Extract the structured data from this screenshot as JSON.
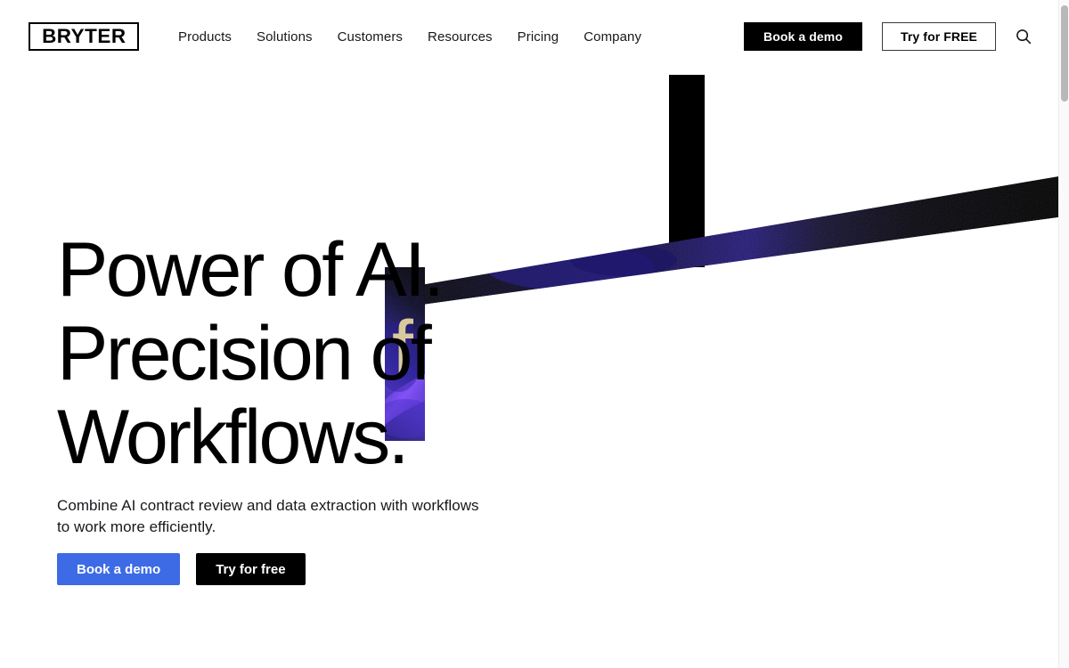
{
  "header": {
    "logo": {
      "text": "BRYTER",
      "name": "bryter-logo"
    },
    "nav": [
      {
        "label": "Products"
      },
      {
        "label": "Solutions"
      },
      {
        "label": "Customers"
      },
      {
        "label": "Resources"
      },
      {
        "label": "Pricing"
      },
      {
        "label": "Company"
      }
    ],
    "actions": {
      "book_demo_label": "Book a demo",
      "try_free_label": "Try for FREE",
      "search_icon": "search-icon"
    }
  },
  "hero": {
    "headline_lines": [
      "Power of AI.",
      "Precision of",
      "Workflows."
    ],
    "subheadline": "Combine AI contract review and data extraction with workflows to work more efficiently.",
    "ctas": {
      "primary_label": "Book a demo",
      "secondary_label": "Try for free"
    },
    "graphic": {
      "name": "balance-beam-illustration",
      "description": "Abstract seesaw of black bars with purple nebula texture",
      "letter_overlay": "f"
    }
  },
  "colors": {
    "primary_blue": "#3d6be5",
    "black": "#000000",
    "white": "#ffffff",
    "text": "#17181c",
    "border_gray": "#3a3a3a",
    "nebula_purple": "#5b2fd6",
    "nebula_indigo": "#2a1b7a",
    "nebula_gold": "#e8d9a0",
    "scrollbar_thumb": "#b8b8b8",
    "scrollbar_track": "#fafafa"
  },
  "scrollbar": {
    "name": "page-scrollbar",
    "position": "right"
  }
}
